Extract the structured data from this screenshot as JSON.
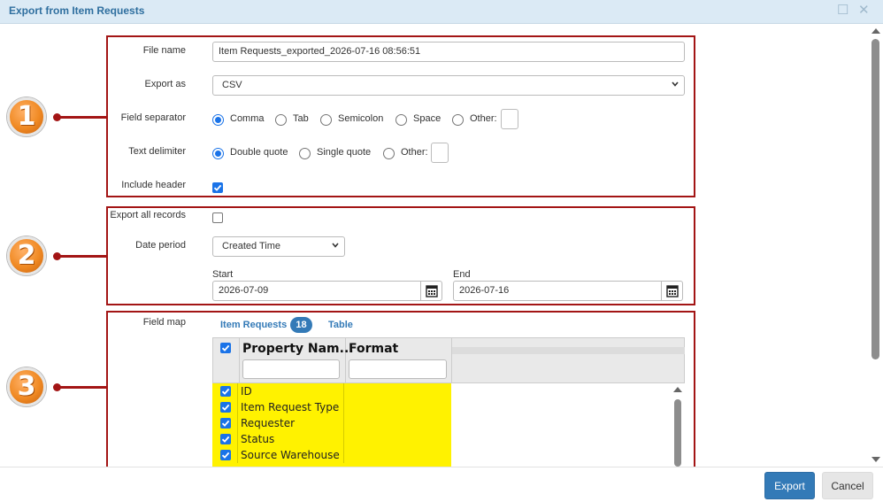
{
  "window": {
    "title": "Export from Item Requests"
  },
  "badges": [
    "1",
    "2",
    "3"
  ],
  "section1": {
    "file_name_label": "File name",
    "file_name_value": "Item Requests_exported_2026-07-16 08:56:51",
    "export_as_label": "Export as",
    "export_as_value": "CSV",
    "field_separator_label": "Field separator",
    "field_separator_options": [
      "Comma",
      "Tab",
      "Semicolon",
      "Space",
      "Other:"
    ],
    "field_separator_selected": "Comma",
    "text_delimiter_label": "Text delimiter",
    "text_delimiter_options": [
      "Double quote",
      "Single quote",
      "Other:"
    ],
    "text_delimiter_selected": "Double quote",
    "include_header_label": "Include header",
    "include_header_checked": true
  },
  "section2": {
    "export_all_label": "Export all records",
    "export_all_checked": false,
    "date_period_label": "Date period",
    "date_period_value": "Created Time",
    "start_label": "Start",
    "start_value": "2026-07-09",
    "end_label": "End",
    "end_value": "2026-07-16"
  },
  "section3": {
    "field_map_label": "Field map",
    "tabs": [
      {
        "label": "Item Requests",
        "count": "18",
        "active": true
      },
      {
        "label": "Table",
        "active": false
      }
    ],
    "columns": [
      "Property Nam...",
      "Format"
    ],
    "rows": [
      {
        "name": "ID",
        "checked": true
      },
      {
        "name": "Item Request Type",
        "checked": true
      },
      {
        "name": "Requester",
        "checked": true
      },
      {
        "name": "Status",
        "checked": true
      },
      {
        "name": "Source Warehouse",
        "checked": true
      }
    ]
  },
  "footer": {
    "export_label": "Export",
    "cancel_label": "Cancel"
  },
  "colors": {
    "accent": "#337ab7",
    "highlight": "#fff200",
    "section_border": "#a31515",
    "badge": "#f08a24"
  }
}
